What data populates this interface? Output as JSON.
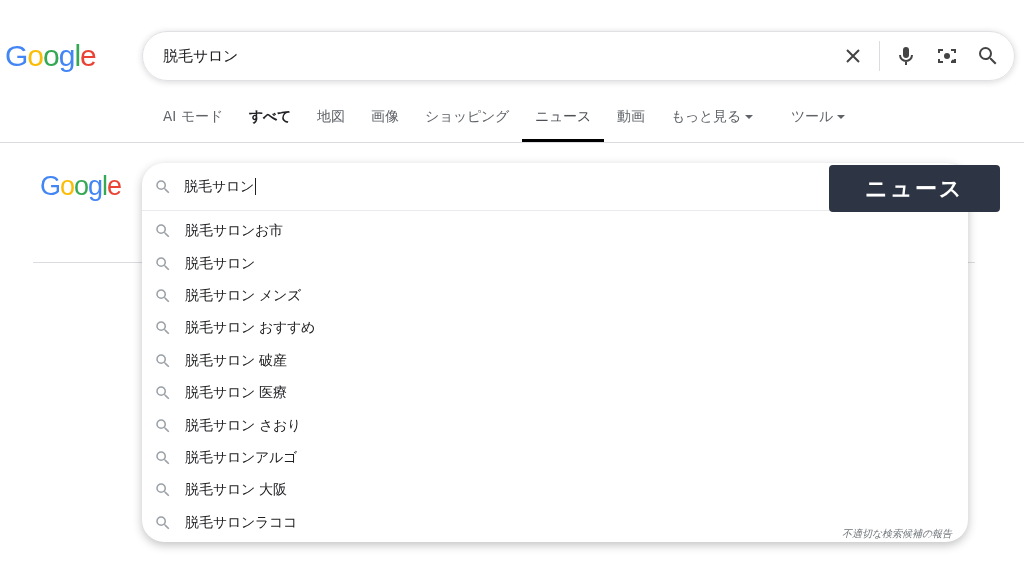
{
  "header": {
    "logo": [
      {
        "char": "G",
        "color": "#4285f4"
      },
      {
        "char": "o",
        "color": "#fbbc05"
      },
      {
        "char": "o",
        "color": "#34a853"
      },
      {
        "char": "g",
        "color": "#4285f4"
      },
      {
        "char": "l",
        "color": "#34a853"
      },
      {
        "char": "e",
        "color": "#ea4335"
      }
    ],
    "search": {
      "value": "脱毛サロン"
    }
  },
  "tabs": [
    {
      "label": "AI モード",
      "selected": false,
      "bold": false,
      "dropdown": false
    },
    {
      "label": "すべて",
      "selected": false,
      "bold": true,
      "dropdown": false
    },
    {
      "label": "地図",
      "selected": false,
      "bold": false,
      "dropdown": false
    },
    {
      "label": "画像",
      "selected": false,
      "bold": false,
      "dropdown": false
    },
    {
      "label": "ショッピング",
      "selected": false,
      "bold": false,
      "dropdown": false
    },
    {
      "label": "ニュース",
      "selected": true,
      "bold": false,
      "dropdown": false
    },
    {
      "label": "動画",
      "selected": false,
      "bold": false,
      "dropdown": false
    },
    {
      "label": "もっと見る",
      "selected": false,
      "bold": false,
      "dropdown": true
    },
    {
      "label": "ツール",
      "selected": false,
      "bold": false,
      "dropdown": true
    }
  ],
  "overlay": {
    "logo": [
      {
        "char": "G",
        "color": "#4285f4"
      },
      {
        "char": "o",
        "color": "#fbbc05"
      },
      {
        "char": "o",
        "color": "#34a853"
      },
      {
        "char": "g",
        "color": "#4285f4"
      },
      {
        "char": "l",
        "color": "#34a853"
      },
      {
        "char": "e",
        "color": "#ea4335"
      }
    ],
    "search": {
      "value": "脱毛サロン"
    },
    "suggestions": [
      "脱毛サロンお市",
      "脱毛サロン",
      "脱毛サロン メンズ",
      "脱毛サロン おすすめ",
      "脱毛サロン 破産",
      "脱毛サロン 医療",
      "脱毛サロン さおり",
      "脱毛サロンアルゴ",
      "脱毛サロン 大阪",
      "脱毛サロンラココ"
    ],
    "report_link": "不適切な検索候補の報告",
    "badge": "ニュース"
  }
}
